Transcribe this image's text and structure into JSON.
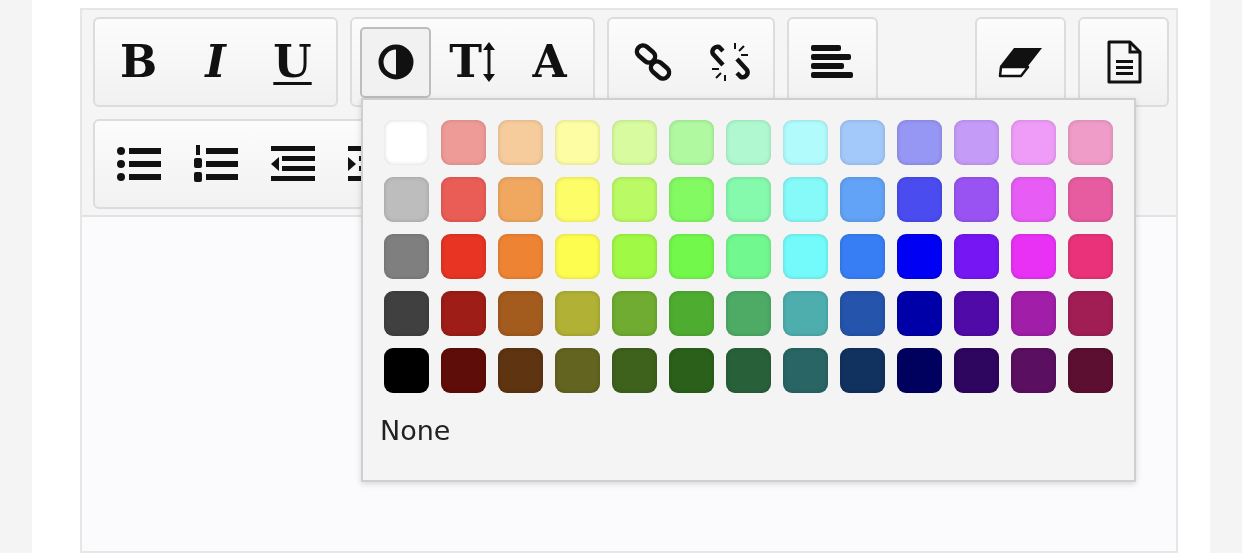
{
  "toolbar": {
    "rows": [
      {
        "groups": [
          {
            "buttons": [
              {
                "kind": "bold",
                "label": "B",
                "selected": false
              },
              {
                "kind": "italic",
                "label": "I",
                "selected": false
              },
              {
                "kind": "underline",
                "label": "U",
                "selected": false
              }
            ]
          },
          {
            "buttons": [
              {
                "kind": "contrast",
                "selected": true
              },
              {
                "kind": "fontsize",
                "label": "T",
                "selected": false
              },
              {
                "kind": "font",
                "label": "A",
                "selected": false
              }
            ]
          },
          {
            "buttons": [
              {
                "kind": "link",
                "selected": false
              },
              {
                "kind": "unlink",
                "selected": false
              }
            ]
          },
          {
            "buttons": [
              {
                "kind": "align",
                "selected": false
              }
            ]
          },
          {
            "buttons": [
              {
                "kind": "eraser",
                "selected": false
              }
            ]
          },
          {
            "buttons": [
              {
                "kind": "file",
                "selected": false
              }
            ]
          }
        ]
      },
      {
        "groups": [
          {
            "buttons": [
              {
                "kind": "bullets",
                "selected": false
              },
              {
                "kind": "numbers",
                "selected": false
              },
              {
                "kind": "outdent",
                "selected": false
              },
              {
                "kind": "indent",
                "selected": false
              }
            ]
          }
        ]
      }
    ]
  },
  "color_popup": {
    "swatches": [
      {
        "color": "#ffffff"
      },
      {
        "color": "#ee9b98"
      },
      {
        "color": "#f6cc9d"
      },
      {
        "color": "#fdfda4"
      },
      {
        "color": "#d8fba0"
      },
      {
        "color": "#b0f9a0"
      },
      {
        "color": "#b0f9d0"
      },
      {
        "color": "#b2fbfc"
      },
      {
        "color": "#a3c9fb"
      },
      {
        "color": "#9696f4"
      },
      {
        "color": "#c59bf8"
      },
      {
        "color": "#ef9cf8"
      },
      {
        "color": "#ef9cc8"
      },
      {
        "color": "#bdbdbd"
      },
      {
        "color": "#e95d56"
      },
      {
        "color": "#f0a860"
      },
      {
        "color": "#fdfd68"
      },
      {
        "color": "#bafa64"
      },
      {
        "color": "#83f962"
      },
      {
        "color": "#85f9ac"
      },
      {
        "color": "#86f9f9"
      },
      {
        "color": "#62a2f7"
      },
      {
        "color": "#4a4cf0"
      },
      {
        "color": "#9953f3"
      },
      {
        "color": "#e75cf4"
      },
      {
        "color": "#e75ca0"
      },
      {
        "color": "#7f7f7f"
      },
      {
        "color": "#e73423"
      },
      {
        "color": "#ee8433"
      },
      {
        "color": "#fdfd4f"
      },
      {
        "color": "#a0f945"
      },
      {
        "color": "#72f84b"
      },
      {
        "color": "#71f88f"
      },
      {
        "color": "#73fbfb"
      },
      {
        "color": "#377ef5"
      },
      {
        "color": "#0000f5"
      },
      {
        "color": "#7617f3"
      },
      {
        "color": "#e831f5"
      },
      {
        "color": "#e93279"
      },
      {
        "color": "#404040"
      },
      {
        "color": "#9e1d16"
      },
      {
        "color": "#a35b1e"
      },
      {
        "color": "#b0b135"
      },
      {
        "color": "#6fac31"
      },
      {
        "color": "#4eac30"
      },
      {
        "color": "#4dab65"
      },
      {
        "color": "#4eaeae"
      },
      {
        "color": "#2454ab"
      },
      {
        "color": "#0000a8"
      },
      {
        "color": "#500aa7"
      },
      {
        "color": "#a01ea8"
      },
      {
        "color": "#a01e54"
      },
      {
        "color": "#000000"
      },
      {
        "color": "#5f0d08"
      },
      {
        "color": "#5e3411"
      },
      {
        "color": "#636420"
      },
      {
        "color": "#3e611c"
      },
      {
        "color": "#2a601a"
      },
      {
        "color": "#286139"
      },
      {
        "color": "#286564"
      },
      {
        "color": "#11315f"
      },
      {
        "color": "#00005f"
      },
      {
        "color": "#2e055f"
      },
      {
        "color": "#5a0f60"
      },
      {
        "color": "#5c0f30"
      }
    ],
    "none_label": "None"
  }
}
